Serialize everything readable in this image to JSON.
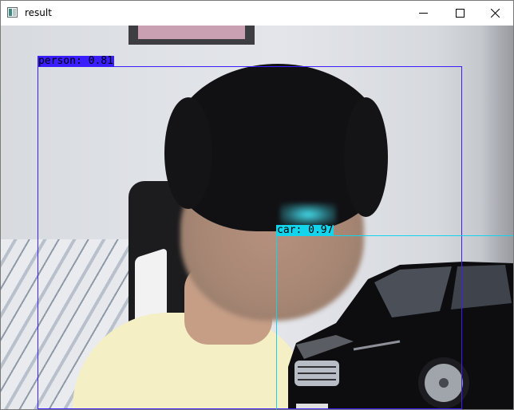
{
  "window": {
    "title": "result",
    "controls": {
      "minimize": "minimize",
      "maximize": "maximize",
      "close": "close"
    }
  },
  "detections": [
    {
      "label": "person: 0.81",
      "class": "person",
      "score": 0.81,
      "color": "#3a1eff"
    },
    {
      "label": "car: 0.97",
      "class": "car",
      "score": 0.97,
      "color": "#12d4ec"
    }
  ],
  "colors": {
    "titlebar": "#ffffff",
    "person_box": "#3a1eff",
    "car_box": "#12d4ec"
  }
}
